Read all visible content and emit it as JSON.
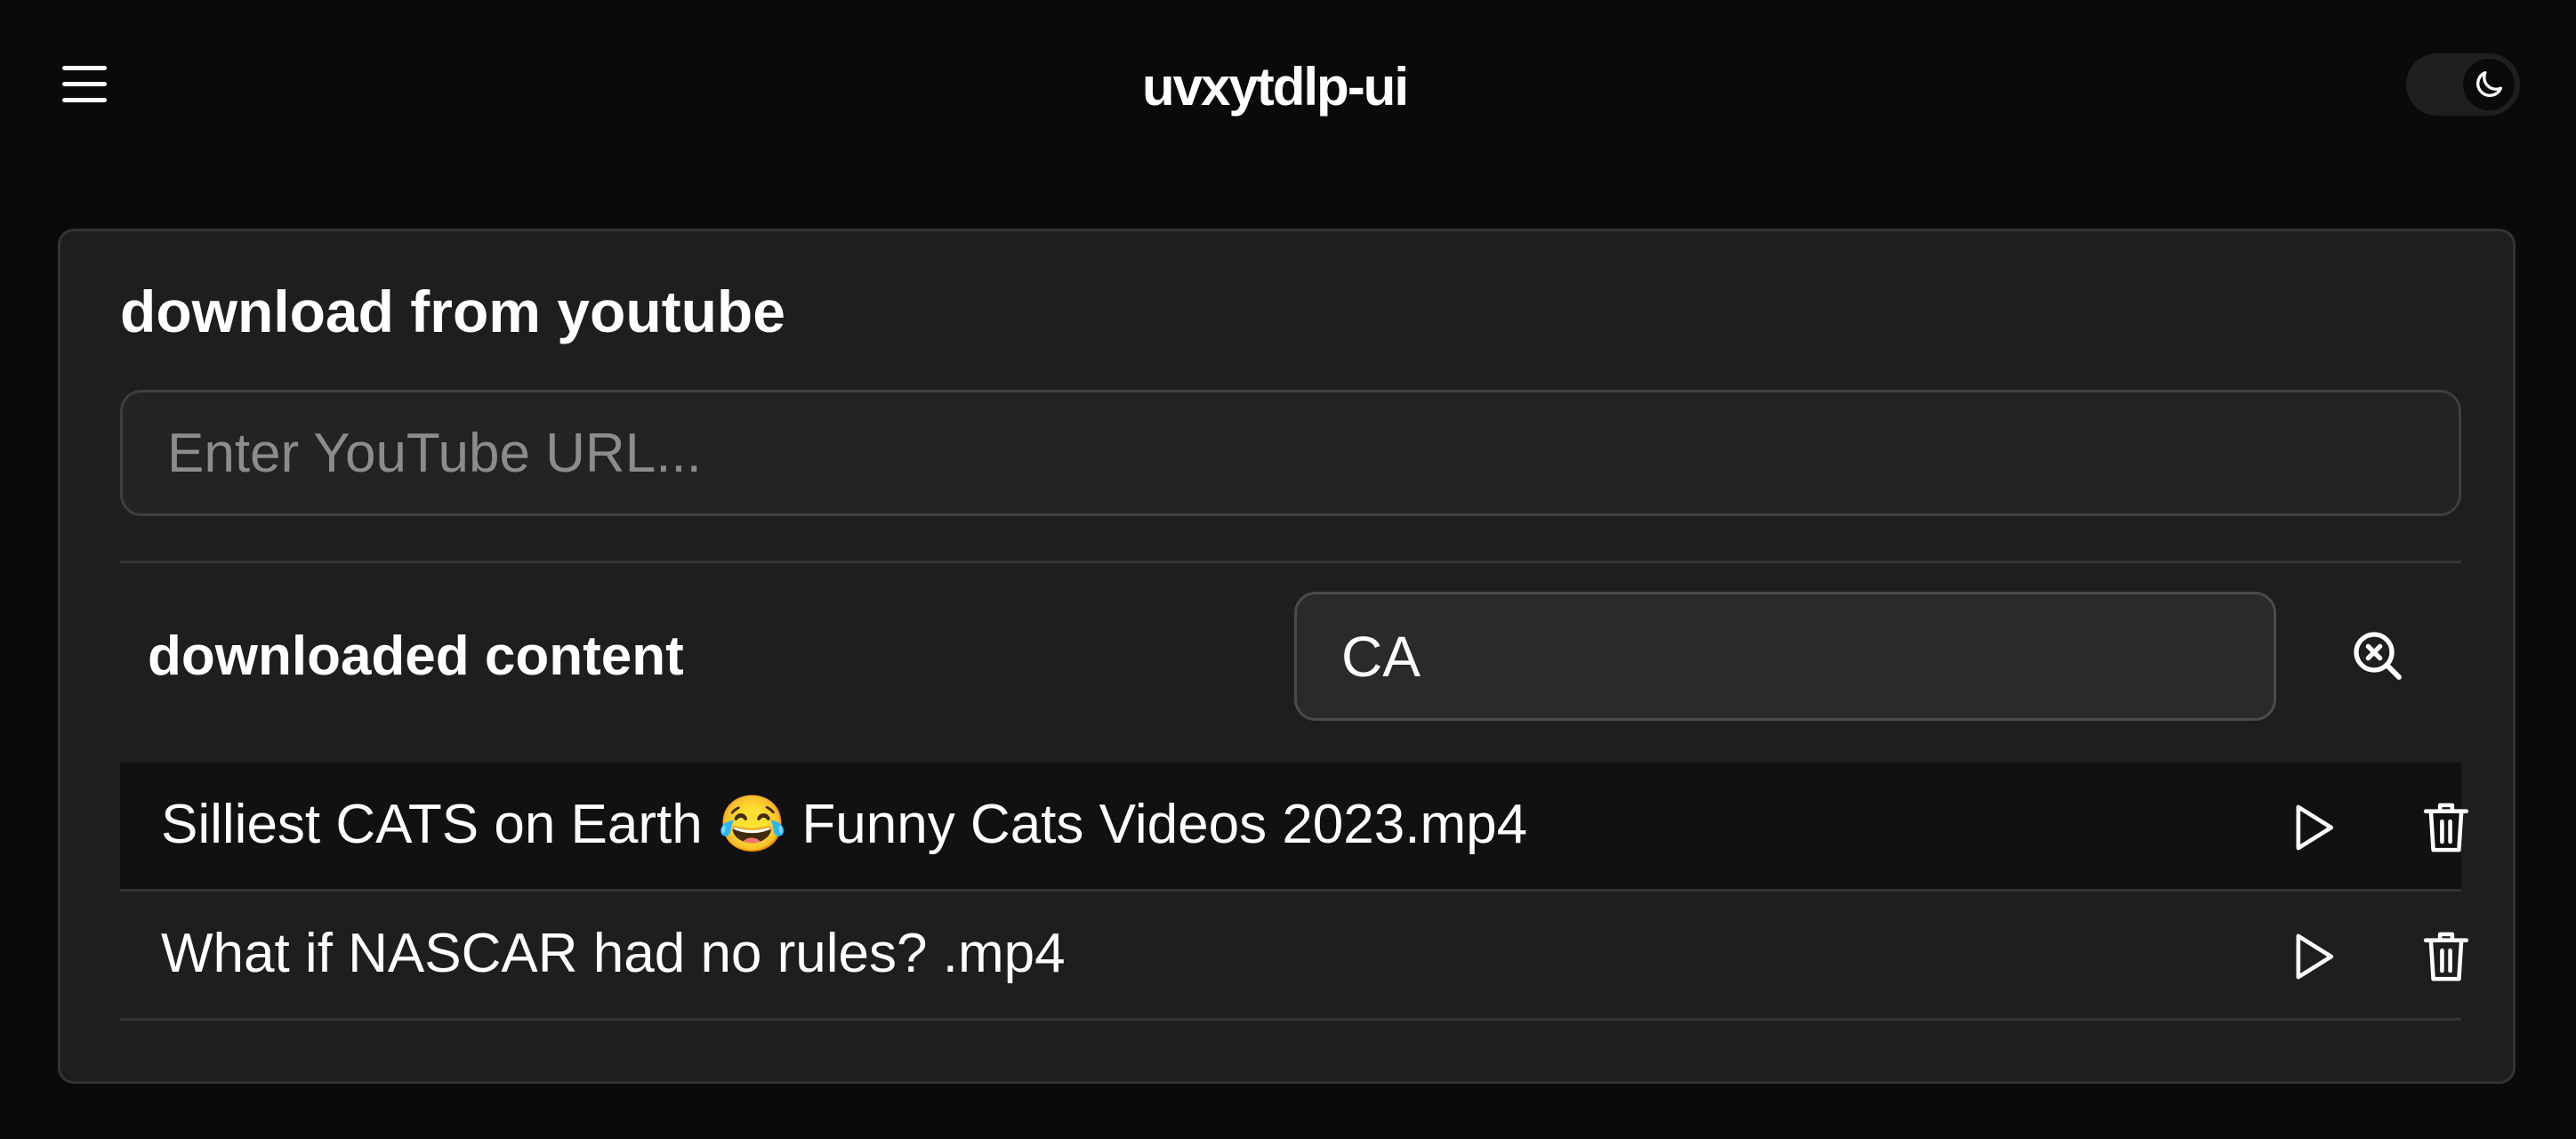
{
  "header": {
    "title": "uvxytdlp-ui",
    "menu_icon": "hamburger-menu-icon",
    "theme_icon": "moon-icon"
  },
  "download_card": {
    "title": "download from youtube",
    "url_input": {
      "value": "",
      "placeholder": "Enter YouTube URL..."
    }
  },
  "downloaded": {
    "title": "downloaded content",
    "search_input": {
      "value": "CA"
    },
    "clear_search_icon": "search-clear-icon",
    "files": [
      {
        "name": "Silliest CATS on Earth 😂 Funny Cats Videos 2023.mp4"
      },
      {
        "name": "What if NASCAR had no rules?  .mp4"
      }
    ],
    "row_actions": {
      "play_icon": "play-icon",
      "delete_icon": "trash-icon"
    }
  },
  "colors": {
    "background": "#0a0a0a",
    "card": "#1e1e1e",
    "row_dark": "#111111",
    "text": "#ffffff",
    "placeholder": "#8c8c8c"
  }
}
